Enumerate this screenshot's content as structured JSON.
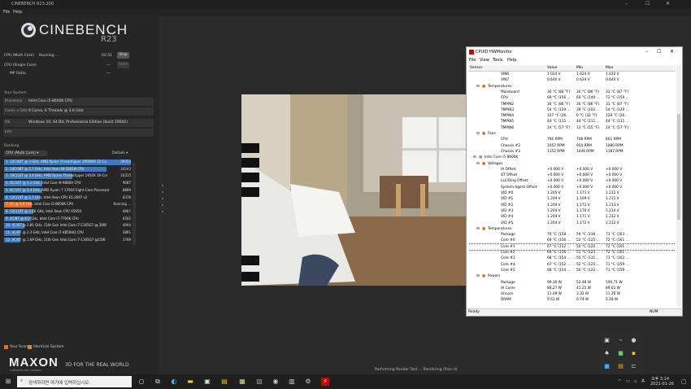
{
  "window": {
    "title": "CINEBENCH R23.200",
    "controls": [
      "–",
      "☐",
      "✕"
    ]
  },
  "menu": [
    "File",
    "Help"
  ],
  "logo": {
    "name": "CINEBENCH",
    "version": "R23"
  },
  "tests": {
    "multi": {
      "label": "CPU (Multi Core)",
      "status": "Running ...",
      "time": "02:51",
      "button": "Stop"
    },
    "single": {
      "label": "CPU (Single Core)",
      "status": "---",
      "button": "Start"
    },
    "mp": {
      "label": "MP Ratio",
      "value": "---"
    }
  },
  "system": {
    "heading": "Your System",
    "rows": [
      {
        "key": "Processor",
        "value": "Intel Core i5-8600K CPU"
      },
      {
        "key": "Cores x GHz",
        "value": "6 Cores, 6 Threads @ 3.6 GHz"
      },
      {
        "key": "OS",
        "value": "Windows 10, 64 Bit, Professional Edition (build 19042)"
      },
      {
        "key": "Info",
        "value": ""
      }
    ]
  },
  "ranking": {
    "heading": "Ranking",
    "dropdown": "CPU (Multi Core)",
    "details": "Details",
    "items": [
      {
        "label": "1. 32C/64T @ 3 GHz, AMD Ryzen Threadripper 2990WX 32-Co",
        "score": "30054",
        "pct": 1.0,
        "me": false
      },
      {
        "label": "2. 24C/48T @ 2.7 GHz, Intel Xeon W-3265M CPU",
        "score": "24243",
        "pct": 0.81,
        "me": false
      },
      {
        "label": "3. 16C/32T @ 3.4 GHz, AMD Ryzen Threadripper 1950X 16-Cor",
        "score": "16315",
        "pct": 0.54,
        "me": false
      },
      {
        "label": "4. 8C/16T @ 2.3 GHz, Intel Core i9-9880H CPU",
        "score": "9087",
        "pct": 0.3,
        "me": false
      },
      {
        "label": "5. 8C/16T @ 3.4 GHz, AMD Ryzen 7 1700X Eight-Core Processor",
        "score": "8889",
        "pct": 0.3,
        "me": false
      },
      {
        "label": "6. 12C/24T @ 2.7 GHz, Intel Xeon CPU E5-2697 v2",
        "score": "8378",
        "pct": 0.28,
        "me": false
      },
      {
        "label": "7. 6C @ 3.6 GHz, Intel Core i5-8600K CPU",
        "score": "Running ...",
        "pct": 0.22,
        "me": true
      },
      {
        "label": "8. 12C/24T @ 2.66 GHz, Intel Xeon CPU X5650",
        "score": "6867",
        "pct": 0.23,
        "me": false
      },
      {
        "label": "9. 4C/8T @ 4.2 GHz, Intel Core i7-7700K CPU",
        "score": "6302",
        "pct": 0.21,
        "me": false
      },
      {
        "label": "10. 4C/8T @ 2.81 GHz, 11th Gen Intel Core i7-1165G7 @ 28W",
        "score": "4904",
        "pct": 0.16,
        "me": false
      },
      {
        "label": "11. 4C/8T @ 2.3 GHz, Intel Core i7-4850HQ CPU",
        "score": "3891",
        "pct": 0.13,
        "me": false
      },
      {
        "label": "12. 4C/8T @ 1.69 GHz, 11th Gen Intel Core i7-1165G7 @15W",
        "score": "3769",
        "pct": 0.13,
        "me": false
      }
    ]
  },
  "legend": {
    "your_score": "Your Score",
    "identical": "Identical System"
  },
  "brand": {
    "maxon": "MAXON",
    "sub": "A NEMETSCHEK COMPANY",
    "tagline": "3D FOR THE REAL WORLD"
  },
  "render_status": "Performing Render Test ... Rendering (Pass 4)",
  "hwmonitor": {
    "title": "CPUID HWMonitor",
    "menu": [
      "File",
      "View",
      "Tools",
      "Help"
    ],
    "columns": [
      "Sensor",
      "Value",
      "Min",
      "Max"
    ],
    "rows": [
      {
        "indent": 4,
        "name": "VIN6",
        "value": "1.024 V",
        "min": "1.024 V",
        "max": "1.032 V"
      },
      {
        "indent": 4,
        "name": "VIN7",
        "value": "0.640 V",
        "min": "0.624 V",
        "max": "0.640 V"
      },
      {
        "indent": 2,
        "name": "Temperatures",
        "value": "",
        "min": "",
        "max": ""
      },
      {
        "indent": 4,
        "name": "Mainboard",
        "value": "30 °C  (86 °F)",
        "min": "30 °C  (86 °F)",
        "max": "31 °C  (87 °F)"
      },
      {
        "indent": 4,
        "name": "CPU",
        "value": "69 °C  (156 ...",
        "min": "60 °C  (140 ...",
        "max": "71 °C  (159 ..."
      },
      {
        "indent": 4,
        "name": "TMPIN2",
        "value": "30 °C  (86 °F)",
        "min": "30 °C  (86 °F)",
        "max": "31 °C  (87 °F)"
      },
      {
        "indent": 4,
        "name": "TMPIN3",
        "value": "54 °C  (129 ...",
        "min": "39 °C  (102 ...",
        "max": "54 °C  (129 ..."
      },
      {
        "indent": 4,
        "name": "TMPIN4",
        "value": "127 °C  (26...",
        "min": "0 °C  (32 °F)",
        "max": "128 °C  (26..."
      },
      {
        "indent": 4,
        "name": "TMPIN5",
        "value": "44 °C  (111 ...",
        "min": "44 °C  (111 ...",
        "max": "44 °C  (111 ..."
      },
      {
        "indent": 4,
        "name": "TMPIN6",
        "value": "14 °C  (57 °F)",
        "min": "13 °C  (55 °F)",
        "max": "14 °C  (57 °F)"
      },
      {
        "indent": 2,
        "name": "Fans",
        "value": "",
        "min": "",
        "max": ""
      },
      {
        "indent": 4,
        "name": "CPU",
        "value": "795 RPM",
        "min": "708 RPM",
        "max": "801 RPM"
      },
      {
        "indent": 4,
        "name": "Chassis #2",
        "value": "1057 RPM",
        "min": "954 RPM",
        "max": "1080 RPM"
      },
      {
        "indent": 4,
        "name": "Chassis #3",
        "value": "1152 RPM",
        "min": "1046 RPM",
        "max": "1187 RPM"
      },
      {
        "indent": 1,
        "name": "Intel Core i5 8600K",
        "value": "",
        "min": "",
        "max": ""
      },
      {
        "indent": 2,
        "name": "Voltages",
        "value": "",
        "min": "",
        "max": ""
      },
      {
        "indent": 4,
        "name": "IA Offset",
        "value": "+0.000 V",
        "min": "+0.000 V",
        "max": "+0.000 V"
      },
      {
        "indent": 4,
        "name": "GT Offset",
        "value": "+0.000 V",
        "min": "+0.000 V",
        "max": "+0.000 V"
      },
      {
        "indent": 4,
        "name": "LLC/Ring Offset",
        "value": "+0.000 V",
        "min": "+0.000 V",
        "max": "+0.000 V"
      },
      {
        "indent": 4,
        "name": "System Agent Offset",
        "value": "+0.000 V",
        "min": "+0.000 V",
        "max": "+0.000 V"
      },
      {
        "indent": 4,
        "name": "VID #0",
        "value": "1.205 V",
        "min": "1.171 V",
        "max": "1.212 V"
      },
      {
        "indent": 4,
        "name": "VID #1",
        "value": "1.204 V",
        "min": "1.169 V",
        "max": "1.211 V"
      },
      {
        "indent": 4,
        "name": "VID #2",
        "value": "1.204 V",
        "min": "1.172 V",
        "max": "1.213 V"
      },
      {
        "indent": 4,
        "name": "VID #3",
        "value": "1.204 V",
        "min": "1.170 V",
        "max": "1.214 V"
      },
      {
        "indent": 4,
        "name": "VID #4",
        "value": "1.204 V",
        "min": "1.171 V",
        "max": "1.212 V"
      },
      {
        "indent": 4,
        "name": "VID #5",
        "value": "1.204 V",
        "min": "1.172 V",
        "max": "1.212 V"
      },
      {
        "indent": 2,
        "name": "Temperatures",
        "value": "",
        "min": "",
        "max": ""
      },
      {
        "indent": 4,
        "name": "Package",
        "value": "70 °C  (158 ...",
        "min": "59 °C  (138 ...",
        "max": "73 °C  (163 ..."
      },
      {
        "indent": 4,
        "name": "Core #0",
        "value": "69 °C  (156 ...",
        "min": "52 °C  (125 ...",
        "max": "72 °C  (161 ..."
      },
      {
        "indent": 4,
        "name": "Core #1",
        "value": "67 °C  (152 ...",
        "min": "50 °C  (122 ...",
        "max": "72 °C  (161 ..."
      },
      {
        "indent": 4,
        "name": "Core #2",
        "value": "69 °C  (156 ...",
        "min": "51 °C  (123 ...",
        "max": "72 °C  (161 ..."
      },
      {
        "indent": 4,
        "name": "Core #3",
        "value": "68 °C  (154 ...",
        "min": "55 °C  (131 ...",
        "max": "73 °C  (163 ..."
      },
      {
        "indent": 4,
        "name": "Core #4",
        "value": "67 °C  (152 ...",
        "min": "52 °C  (125 ...",
        "max": "71 °C  (159 ..."
      },
      {
        "indent": 4,
        "name": "Core #5",
        "value": "68 °C  (154 ...",
        "min": "50 °C  (122 ...",
        "max": "71 °C  (159 ..."
      },
      {
        "indent": 2,
        "name": "Powers",
        "value": "",
        "min": "",
        "max": ""
      },
      {
        "indent": 4,
        "name": "Package",
        "value": "99.36 W",
        "min": "52.48 W",
        "max": "100.71 W"
      },
      {
        "indent": 4,
        "name": "IA Cores",
        "value": "88.27 W",
        "min": "41.25 W",
        "max": "89.61 W"
      },
      {
        "indent": 4,
        "name": "Uncore",
        "value": "11.09 W",
        "min": "3.32 W",
        "max": "11.26 W"
      },
      {
        "indent": 4,
        "name": "DRAM",
        "value": "0.61 W",
        "min": "0.74 W",
        "max": "2.28 W"
      }
    ],
    "status_left": "Ready",
    "status_right": "NUM"
  },
  "taskbar": {
    "search_placeholder": "검색하려면 여기에 입력하십시오.",
    "time": "오후 3:14",
    "date": "2021-01-26",
    "lang": "A"
  }
}
